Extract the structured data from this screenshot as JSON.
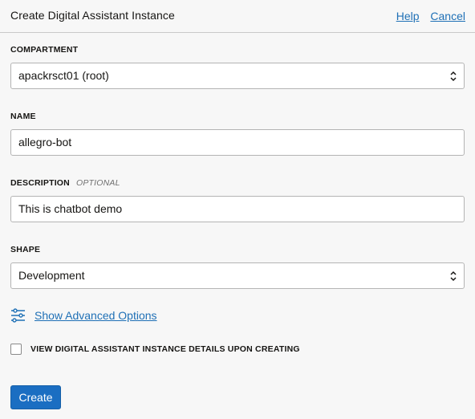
{
  "header": {
    "title": "Create Digital Assistant Instance",
    "help_link": "Help",
    "cancel_link": "Cancel"
  },
  "compartment": {
    "label": "COMPARTMENT",
    "value": "apackrsct01 (root)"
  },
  "name": {
    "label": "NAME",
    "value": "allegro-bot"
  },
  "description": {
    "label": "DESCRIPTION",
    "optional_tag": "OPTIONAL",
    "value": "This is chatbot demo"
  },
  "shape": {
    "label": "SHAPE",
    "value": "Development"
  },
  "advanced": {
    "icon": "sliders-icon",
    "link": "Show Advanced Options"
  },
  "view_details": {
    "label": "VIEW DIGITAL ASSISTANT INSTANCE DETAILS UPON CREATING",
    "checked": false
  },
  "actions": {
    "create_label": "Create"
  },
  "colors": {
    "accent": "#1b6ec2",
    "link": "#1f70b6",
    "background": "#f7f7f7"
  }
}
